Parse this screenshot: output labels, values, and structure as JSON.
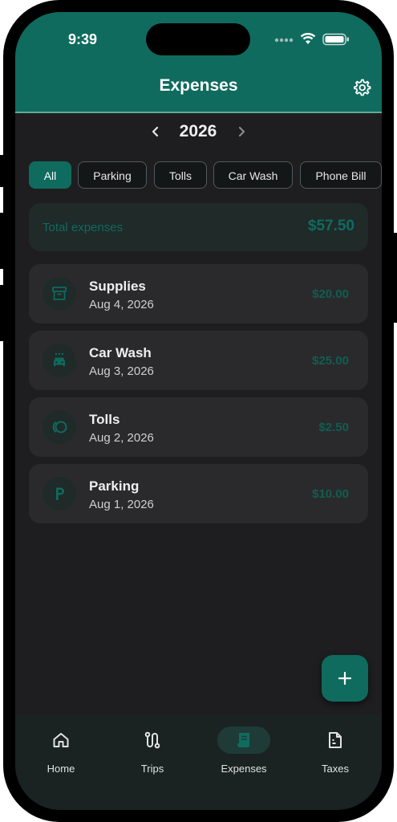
{
  "status_bar": {
    "time": "9:39"
  },
  "header": {
    "title": "Expenses",
    "settings_icon": "gear-icon"
  },
  "year_selector": {
    "year": "2026",
    "prev_icon": "chevron-left-icon",
    "next_icon": "chevron-right-icon"
  },
  "filters": [
    {
      "label": "All",
      "active": true
    },
    {
      "label": "Parking",
      "active": false
    },
    {
      "label": "Tolls",
      "active": false
    },
    {
      "label": "Car Wash",
      "active": false
    },
    {
      "label": "Phone Bill",
      "active": false
    }
  ],
  "total": {
    "label": "Total expenses",
    "amount": "$57.50"
  },
  "expenses": [
    {
      "name": "Supplies",
      "date": "Aug 4, 2026",
      "amount": "$20.00",
      "icon": "archive-box-icon"
    },
    {
      "name": "Car Wash",
      "date": "Aug 3, 2026",
      "amount": "$25.00",
      "icon": "car-wash-icon"
    },
    {
      "name": "Tolls",
      "date": "Aug 2, 2026",
      "amount": "$2.50",
      "icon": "toll-icon"
    },
    {
      "name": "Parking",
      "date": "Aug 1, 2026",
      "amount": "$10.00",
      "icon": "parking-icon"
    }
  ],
  "fab": {
    "icon": "plus-icon"
  },
  "tabs": [
    {
      "label": "Home",
      "icon": "home-icon",
      "active": false
    },
    {
      "label": "Trips",
      "icon": "route-icon",
      "active": false
    },
    {
      "label": "Expenses",
      "icon": "receipt-icon",
      "active": true
    },
    {
      "label": "Taxes",
      "icon": "document-icon",
      "active": false
    }
  ],
  "colors": {
    "accent": "#0f6b5e",
    "background": "#1e1e20",
    "card": "#2a2a2c"
  }
}
